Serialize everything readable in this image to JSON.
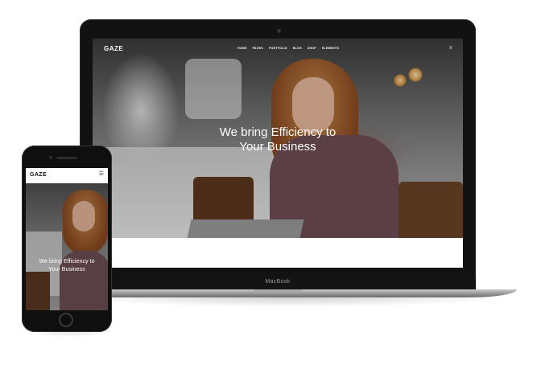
{
  "laptop": {
    "brand_label": "MacBook",
    "site": {
      "logo": "GAZE",
      "menu": [
        "HOME",
        "PAGES",
        "PORTFOLIO",
        "BLOG",
        "SHOP",
        "ELEMENTS"
      ],
      "hero_title_line1": "We bring Efficiency to",
      "hero_title_line2": "Your Business"
    }
  },
  "phone": {
    "site": {
      "logo": "GAZE",
      "hero_title_line1": "We bring Efficiency to",
      "hero_title_line2": "Your Business"
    }
  }
}
